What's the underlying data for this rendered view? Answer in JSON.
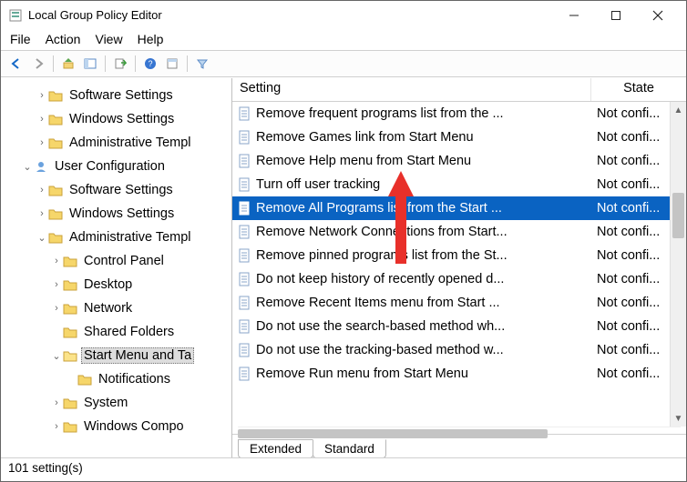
{
  "window": {
    "title": "Local Group Policy Editor"
  },
  "menu": {
    "file": "File",
    "action": "Action",
    "view": "View",
    "help": "Help"
  },
  "tree": {
    "n0": "Software Settings",
    "n1": "Windows Settings",
    "n2": "Administrative Templ",
    "n3": "User Configuration",
    "n4": "Software Settings",
    "n5": "Windows Settings",
    "n6": "Administrative Templ",
    "n7": "Control Panel",
    "n8": "Desktop",
    "n9": "Network",
    "n10": "Shared Folders",
    "n11": "Start Menu and Ta",
    "n12": "Notifications",
    "n13": "System",
    "n14": "Windows Compo"
  },
  "columns": {
    "setting": "Setting",
    "state": "State"
  },
  "rows": [
    {
      "name": "Remove frequent programs list from the ...",
      "state": "Not confi..."
    },
    {
      "name": "Remove Games link from Start Menu",
      "state": "Not confi..."
    },
    {
      "name": "Remove Help menu from Start Menu",
      "state": "Not confi..."
    },
    {
      "name": "Turn off user tracking",
      "state": "Not confi..."
    },
    {
      "name": "Remove All Programs list from the Start ...",
      "state": "Not confi..."
    },
    {
      "name": "Remove Network Connections from Start...",
      "state": "Not confi..."
    },
    {
      "name": "Remove pinned programs list from the St...",
      "state": "Not confi..."
    },
    {
      "name": "Do not keep history of recently opened d...",
      "state": "Not confi..."
    },
    {
      "name": "Remove Recent Items menu from Start ...",
      "state": "Not confi..."
    },
    {
      "name": "Do not use the search-based method wh...",
      "state": "Not confi..."
    },
    {
      "name": "Do not use the tracking-based method w...",
      "state": "Not confi..."
    },
    {
      "name": "Remove Run menu from Start Menu",
      "state": "Not confi..."
    }
  ],
  "tabs": {
    "extended": "Extended",
    "standard": "Standard"
  },
  "status": "101 setting(s)",
  "colors": {
    "selection": "#0a63c2",
    "arrow": "#e8302a"
  }
}
